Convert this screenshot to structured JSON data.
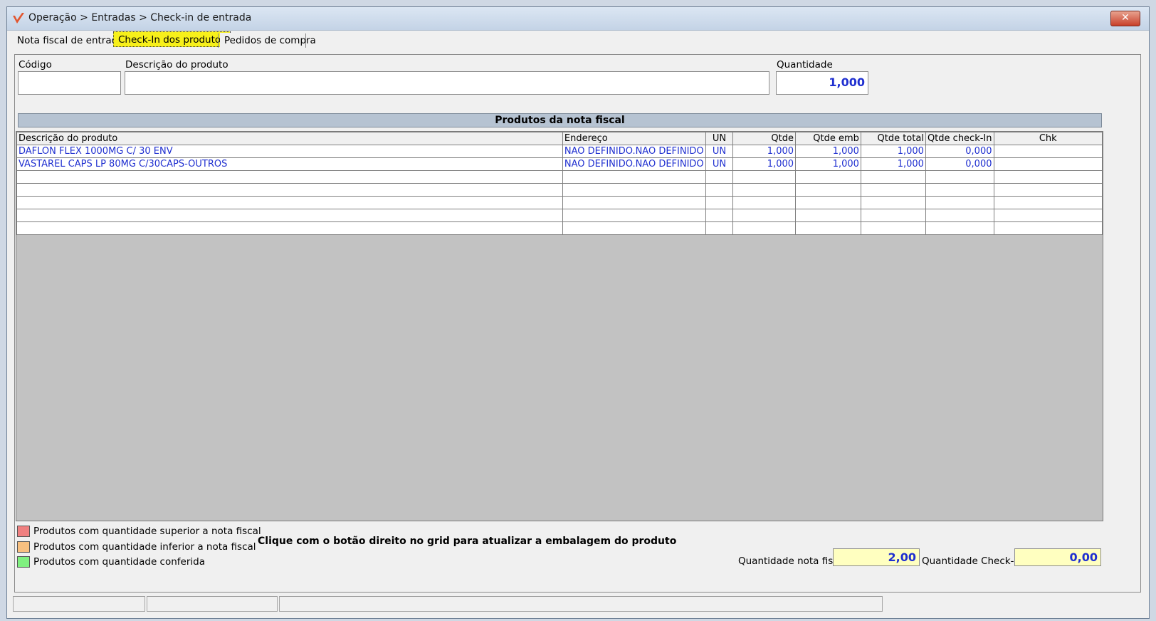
{
  "window": {
    "title": "Operação > Entradas > Check-in de entrada",
    "close_label": "✕"
  },
  "tabs": [
    {
      "label": "Nota fiscal de entrada"
    },
    {
      "label": "Check-In dos produtos"
    },
    {
      "label": "Pedidos de compra"
    }
  ],
  "form": {
    "code_label": "Código",
    "code_value": "",
    "description_label": "Descrição do produto",
    "description_value": "",
    "quantity_label": "Quantidade",
    "quantity_value": "1,000"
  },
  "grid": {
    "title": "Produtos da nota fiscal",
    "columns": [
      "Descrição do produto",
      "Endereço",
      "UN",
      "Qtde",
      "Qtde emb",
      "Qtde total",
      "Qtde check-In",
      "Chk"
    ],
    "rows": [
      [
        "DAFLON FLEX 1000MG C/ 30 ENV",
        "NAO DEFINIDO.NAO DEFINIDO",
        "UN",
        "1,000",
        "1,000",
        "1,000",
        "0,000",
        ""
      ],
      [
        "VASTAREL CAPS LP 80MG C/30CAPS-OUTROS",
        "NAO DEFINIDO.NAO DEFINIDO",
        "UN",
        "1,000",
        "1,000",
        "1,000",
        "0,000",
        ""
      ]
    ],
    "empty_rows": 5
  },
  "legend": [
    {
      "label": "Produtos com quantidade superior a nota fiscal",
      "color": "#f08080"
    },
    {
      "label": "Produtos com quantidade inferior a nota fiscal",
      "color": "#f8c080"
    },
    {
      "label": "Produtos com quantidade conferida",
      "color": "#80f080"
    }
  ],
  "hint": "Clique com o botão direito no grid para atualizar a embalagem do produto",
  "totals": {
    "invoice_qty_label": "Quantidade nota fiscal:",
    "invoice_qty_value": "2,00",
    "checkin_qty_label": "Quantidade Check-In:",
    "checkin_qty_value": "0,00"
  },
  "colors": {
    "active_tab": "#f7f01a",
    "value_text": "#1f2fd0",
    "total_field_bg": "#ffffc0",
    "grid_title_bg": "#b6c3d2"
  }
}
